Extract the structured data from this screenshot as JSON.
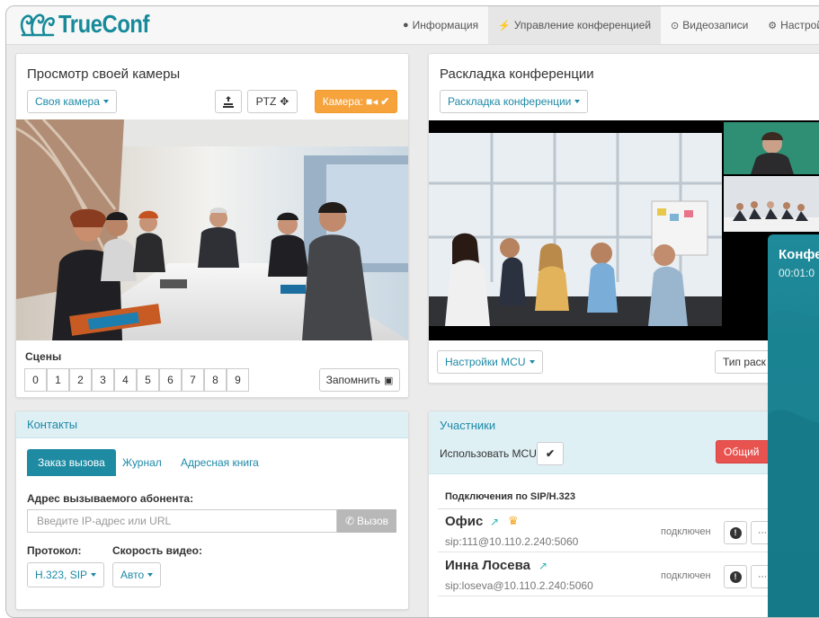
{
  "header": {
    "logo_text": "TrueConf",
    "nav": [
      {
        "label": "Информация",
        "icon": "info-circle-icon"
      },
      {
        "label": "Управление конференцией",
        "icon": "lightning-icon"
      },
      {
        "label": "Видеозаписи",
        "icon": "record-icon"
      },
      {
        "label": "Настройки",
        "icon": "gear-icon"
      }
    ]
  },
  "camera_panel": {
    "title": "Просмотр своей камеры",
    "source_dropdown": "Своя камера",
    "ptz_label": "PTZ",
    "camera_toggle_label": "Камера:",
    "scenes_label": "Сцены",
    "scenes": [
      "0",
      "1",
      "2",
      "3",
      "4",
      "5",
      "6",
      "7",
      "8",
      "9"
    ],
    "save_label": "Запомнить"
  },
  "layout_panel": {
    "title": "Раскладка конференции",
    "layout_dropdown": "Раскладка конференции",
    "mcu_settings_dropdown": "Настройки MCU",
    "layout_type_button": "Тип раск"
  },
  "contacts_panel": {
    "title": "Контакты",
    "tabs": [
      "Заказ вызова",
      "Журнал",
      "Адресная книга"
    ],
    "address_label": "Адрес вызываемого абонента:",
    "address_placeholder": "Введите IP-адрес или URL",
    "call_button": "Вызов",
    "protocol_label": "Протокол:",
    "protocol_value": "H.323, SIP",
    "speed_label": "Скорость видео:",
    "speed_value": "Авто"
  },
  "participants_panel": {
    "title": "Участники",
    "use_mcu_label": "Использовать MCU:",
    "general_button": "Общий",
    "section_header": "Подключения по SIP/H.323",
    "rows": [
      {
        "name": "Офис",
        "sip": "sip:111@10.110.2.240:5060",
        "status": "подключен"
      },
      {
        "name": "Инна Лосева",
        "sip": "sip:loseva@10.110.2.240:5060",
        "status": "подключен"
      }
    ]
  },
  "overlay": {
    "title": "Конфе",
    "time": "00:01:0"
  },
  "colors": {
    "accent": "#1d89a6",
    "orange": "#f6a33c",
    "red": "#e9534f",
    "teal_overlay": "#1a8594"
  }
}
